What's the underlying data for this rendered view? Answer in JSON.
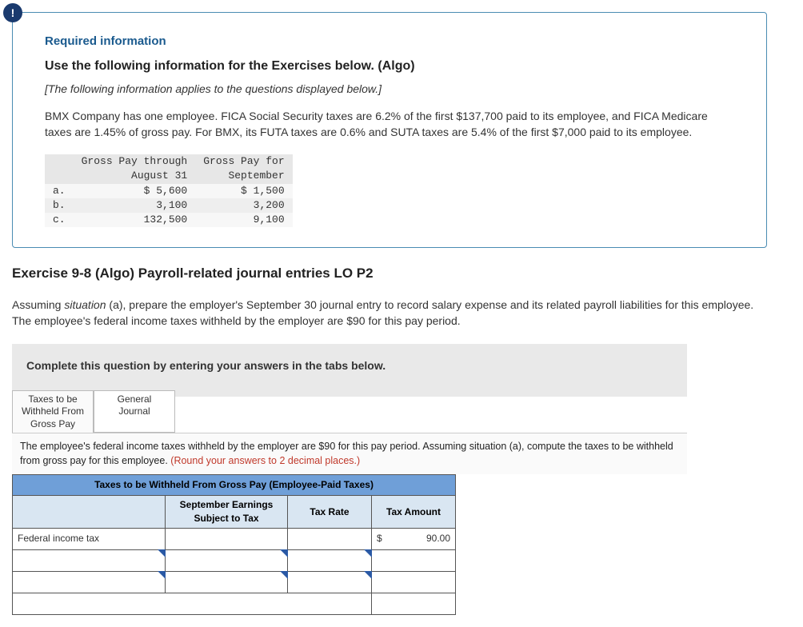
{
  "info_badge": "!",
  "required_info": "Required information",
  "use_following": "Use the following information for the Exercises below. (Algo)",
  "applies": "[The following information applies to the questions displayed below.]",
  "paragraph": "BMX Company has one employee. FICA Social Security taxes are 6.2% of the first $137,700 paid to its employee, and FICA Medicare taxes are 1.45% of gross pay. For BMX, its FUTA taxes are 0.6% and SUTA taxes are 5.4% of the first $7,000 paid to its employee.",
  "gp_table": {
    "head1": "Gross Pay through",
    "head1b": "August 31",
    "head2": "Gross Pay for",
    "head2b": "September",
    "rows": [
      {
        "label": "a.",
        "c1": "$ 5,600",
        "c2": "$ 1,500"
      },
      {
        "label": "b.",
        "c1": "3,100",
        "c2": "3,200"
      },
      {
        "label": "c.",
        "c1": "132,500",
        "c2": "9,100"
      }
    ]
  },
  "exercise_title": "Exercise 9-8 (Algo) Payroll-related journal entries LO P2",
  "exercise_text_pre": "Assuming ",
  "exercise_situation": "situation",
  "exercise_text_post": " (a), prepare the employer's September 30 journal entry to record salary expense and its related payroll liabilities for this employee. The employee's federal income taxes withheld by the employer are $90 for this pay period.",
  "complete_text": "Complete this question by entering your answers in the tabs below.",
  "tabs": {
    "t1_line1": "Taxes to be",
    "t1_line2": "Withheld From",
    "t1_line3": "Gross Pay",
    "t2_line1": "General",
    "t2_line2": "Journal"
  },
  "instruction_main": "The employee's federal income taxes withheld by the employer are $90 for this pay period. Assuming situation (a), compute the taxes to be withheld from gross pay for this employee. ",
  "instruction_round": "(Round your answers to 2 decimal places.)",
  "wtable": {
    "title": "Taxes to be Withheld From Gross Pay (Employee-Paid Taxes)",
    "h1": "",
    "h2": "September Earnings Subject to Tax",
    "h3": "Tax Rate",
    "h4": "Tax Amount",
    "r1_desc": "Federal income tax",
    "r1_amt_sym": "$",
    "r1_amt_val": "90.00"
  }
}
